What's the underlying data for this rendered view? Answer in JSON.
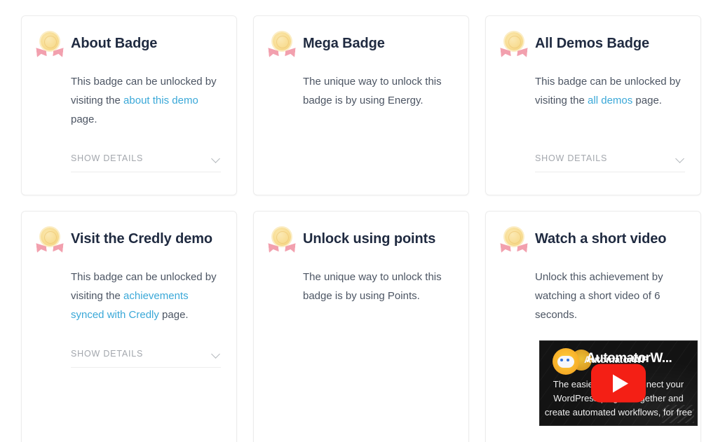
{
  "page": {
    "background": "#ffffff",
    "accent_link": "#3aa8d8",
    "title_color": "#1f2a40",
    "body_color": "#4c5563"
  },
  "common": {
    "show_details_label": "SHOW DETAILS",
    "badge_icon": "rosette-badge-icon",
    "chevron_icon": "chevron-down-icon"
  },
  "cards": [
    {
      "id": "about-badge",
      "title": "About Badge",
      "body_parts": [
        {
          "type": "text",
          "value": "This badge can be unlocked by visiting the "
        },
        {
          "type": "link",
          "value": "about this demo"
        },
        {
          "type": "text",
          "value": " page."
        }
      ],
      "has_details": true,
      "has_video": false
    },
    {
      "id": "mega-badge",
      "title": "Mega Badge",
      "body_parts": [
        {
          "type": "text",
          "value": "The unique way to unlock this badge is by using Energy."
        }
      ],
      "has_details": false,
      "has_video": false
    },
    {
      "id": "all-demos-badge",
      "title": "All Demos Badge",
      "body_parts": [
        {
          "type": "text",
          "value": "This badge can be unlocked by visiting the "
        },
        {
          "type": "link",
          "value": "all demos"
        },
        {
          "type": "text",
          "value": " page."
        }
      ],
      "has_details": true,
      "has_video": false
    },
    {
      "id": "visit-credly-demo",
      "title": "Visit the Credly demo",
      "body_parts": [
        {
          "type": "text",
          "value": "This badge can be unlocked by visiting the "
        },
        {
          "type": "link",
          "value": "achievements synced with Credly"
        },
        {
          "type": "text",
          "value": " page."
        }
      ],
      "has_details": true,
      "has_video": false
    },
    {
      "id": "unlock-using-points",
      "title": "Unlock using points",
      "body_parts": [
        {
          "type": "text",
          "value": "The unique way to unlock this badge is by using Points."
        }
      ],
      "has_details": false,
      "has_video": false
    },
    {
      "id": "watch-a-short-video",
      "title": "Watch a short video",
      "body_parts": [
        {
          "type": "text",
          "value": "Unlock this achievement by watching a short video of 6 seconds."
        }
      ],
      "has_details": false,
      "has_video": true,
      "video": {
        "title_small": "AutomatorWP",
        "title_big": "AutomatorW...",
        "description": "The easiest way to connect your WordPress plugins together and create automated workflows, for free",
        "play_button_icon": "youtube-play-icon",
        "play_button_color": "#f41f15",
        "mascot_icon": "automatorwp-robot-icon"
      }
    }
  ]
}
